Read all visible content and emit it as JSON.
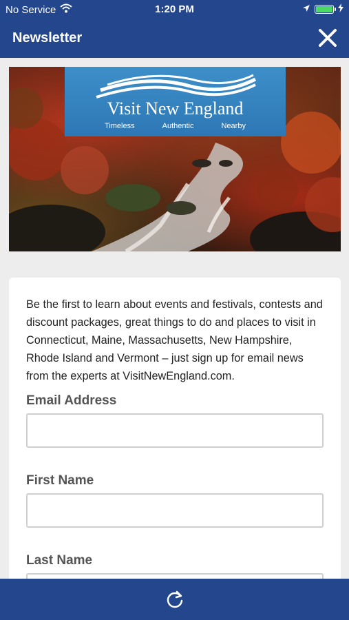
{
  "status_bar": {
    "carrier": "No Service",
    "time": "1:20 PM",
    "icons": [
      "wifi-icon",
      "location-arrow-icon",
      "battery-icon",
      "charging-bolt-icon"
    ]
  },
  "nav": {
    "title": "Newsletter",
    "close_icon": "close-icon"
  },
  "banner": {
    "logo_title": "Visit New England",
    "taglines": [
      "Timeless",
      "Authentic",
      "Nearby"
    ]
  },
  "form": {
    "intro": "Be the first to learn about events and festivals, contests and discount packages, great things to do and places to visit in Connecticut, Maine, Massachusetts, New Hampshire, Rhode Island and Vermont – just sign up for email news from the experts at VisitNewEngland.com.",
    "fields": [
      {
        "label": "Email Address",
        "value": ""
      },
      {
        "label": "First Name",
        "value": ""
      },
      {
        "label": "Last Name",
        "value": ""
      }
    ]
  },
  "toolbar": {
    "refresh_icon": "refresh-icon"
  },
  "colors": {
    "brand_blue": "#23468c",
    "logo_blue": "#3585c2",
    "battery_green": "#4cd964",
    "background": "#ededed"
  }
}
